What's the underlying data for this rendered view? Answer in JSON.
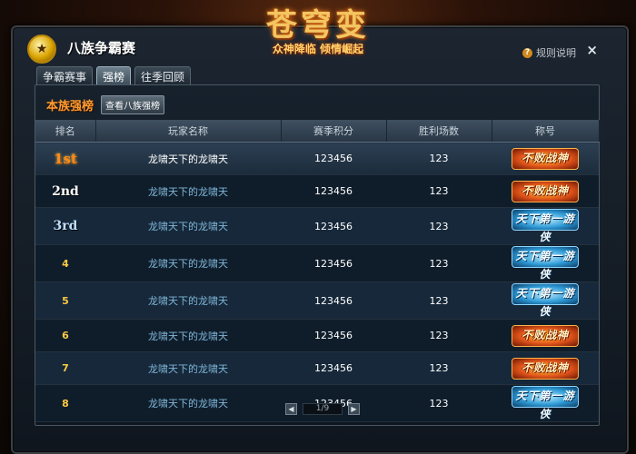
{
  "logo": {
    "title": "苍穹变",
    "subtitle": "众神降临 倾情崛起"
  },
  "window": {
    "title": "八族争霸赛",
    "help_label": "规则说明",
    "close_symbol": "×",
    "medal_symbol": "★"
  },
  "tabs": [
    {
      "label": "争霸赛事",
      "active": false
    },
    {
      "label": "强榜",
      "active": true
    },
    {
      "label": "往季回顾",
      "active": false
    }
  ],
  "subheader": {
    "label": "本族强榜",
    "button": "查看八族强榜"
  },
  "table": {
    "headers": [
      "排名",
      "玩家名称",
      "赛季积分",
      "胜利场数",
      "称号"
    ],
    "rows": [
      {
        "rank": "1st",
        "name": "龙啸天下的龙啸天",
        "points": "123456",
        "wins": "123",
        "title": "不败战神",
        "title_style": "red"
      },
      {
        "rank": "2nd",
        "name": "龙啸天下的龙啸天",
        "points": "123456",
        "wins": "123",
        "title": "不败战神",
        "title_style": "red"
      },
      {
        "rank": "3rd",
        "name": "龙啸天下的龙啸天",
        "points": "123456",
        "wins": "123",
        "title": "天下第一游侠",
        "title_style": "blue"
      },
      {
        "rank": "4",
        "name": "龙啸天下的龙啸天",
        "points": "123456",
        "wins": "123",
        "title": "天下第一游侠",
        "title_style": "blue"
      },
      {
        "rank": "5",
        "name": "龙啸天下的龙啸天",
        "points": "123456",
        "wins": "123",
        "title": "天下第一游侠",
        "title_style": "blue"
      },
      {
        "rank": "6",
        "name": "龙啸天下的龙啸天",
        "points": "123456",
        "wins": "123",
        "title": "不败战神",
        "title_style": "red"
      },
      {
        "rank": "7",
        "name": "龙啸天下的龙啸天",
        "points": "123456",
        "wins": "123",
        "title": "不败战神",
        "title_style": "red"
      },
      {
        "rank": "8",
        "name": "龙啸天下的龙啸天",
        "points": "123456",
        "wins": "123",
        "title": "天下第一游侠",
        "title_style": "blue"
      }
    ]
  },
  "pager": {
    "prev_symbol": "◀",
    "next_symbol": "▶",
    "page": "1/9"
  }
}
